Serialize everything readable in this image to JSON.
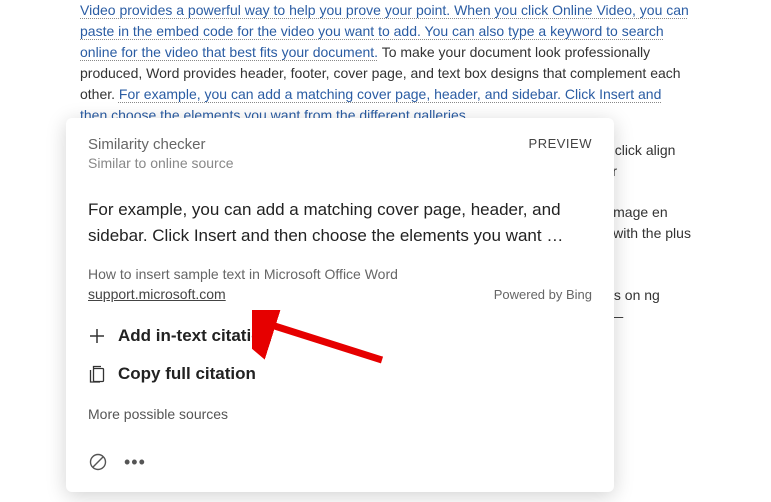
{
  "document": {
    "p1_underlined1": "Video provides a powerful way to help you prove your point. When you click Online Video, you can paste in the embed code for the video you want to add. You can also type a keyword to search online for the video that best fits your document.",
    "p1_regular": " To make your document look professionally produced, Word provides header, footer, cover page, and text box designs that complement each other. ",
    "p1_underlined2": "For example, you can add a matching cover page, header, and sidebar. Click Insert and then choose the elements you want from the different galleries.",
    "hidden1": "hen you click align with your",
    "hidden2": "how an image en working with the plus sign.",
    "hidden3": "s to focus on ng position—"
  },
  "panel": {
    "title": "Similarity checker",
    "preview": "PREVIEW",
    "subtitle": "Similar to online source",
    "excerpt": "For example, you can add a matching cover page, header, and sidebar. Click Insert and then choose the elements you want …",
    "sourceTitle": "How to insert sample text in Microsoft Office Word",
    "sourceLink": "support.microsoft.com",
    "powered": "Powered by Bing",
    "addCitation": "Add in-text citation",
    "copyCitation": "Copy full citation",
    "moreSources": "More possible sources"
  }
}
